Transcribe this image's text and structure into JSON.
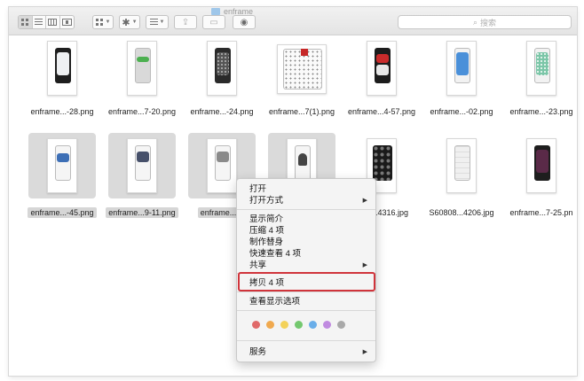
{
  "window": {
    "title": "enframe"
  },
  "toolbar": {
    "view_icons": [
      "icon-view-icon",
      "list-view-icon",
      "column-view-icon",
      "cover-flow-icon"
    ],
    "search_placeholder": "搜索"
  },
  "files": {
    "row1": [
      "enframe...-28.png",
      "enframe...7-20.png",
      "enframe...-24.png",
      "enframe...7(1).png",
      "enframe...4-57.png",
      "enframe...-02.png",
      "enframe...-23.png"
    ],
    "row2": [
      "enframe...-45.png",
      "enframe...9-11.png",
      "enframe...-4",
      "",
      "S60808...4316.jpg",
      "S60808...4206.jpg",
      "enframe...7-25.pn"
    ],
    "row2_prefix_visible": "08...4316.jpg"
  },
  "context_menu": {
    "open": "打开",
    "open_with": "打开方式",
    "get_info": "显示简介",
    "compress": "压缩 4 项",
    "make_alias": "制作替身",
    "quick_look": "快速查看 4 项",
    "share": "共享",
    "copy": "拷贝 4 项",
    "view_options": "查看显示选项",
    "services": "服务",
    "submenu_arrow": "▶"
  },
  "tag_colors": [
    "#e06a6a",
    "#f0a94f",
    "#f3d25a",
    "#74c86f",
    "#6aaee9",
    "#c08be0",
    "#a9a9a9"
  ],
  "colors": {
    "highlight_border": "#d0343b",
    "selection": "#dadada"
  }
}
